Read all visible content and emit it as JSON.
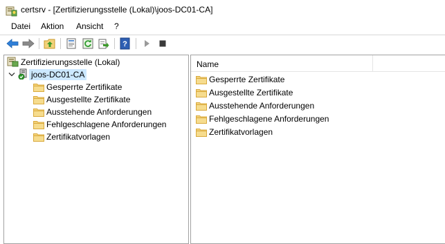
{
  "window": {
    "title": "certsrv - [Zertifizierungsstelle (Lokal)\\joos-DC01-CA]"
  },
  "menu": {
    "items": [
      "Datei",
      "Aktion",
      "Ansicht",
      "?"
    ]
  },
  "toolbar": {
    "buttons": [
      "back-icon",
      "forward-icon",
      "up-folder-icon",
      "properties-icon",
      "refresh-icon",
      "export-icon",
      "help-icon",
      "play-icon",
      "stop-icon"
    ]
  },
  "tree": {
    "root": "Zertifizierungsstelle (Lokal)",
    "ca": "joos-DC01-CA",
    "children": [
      "Gesperrte Zertifikate",
      "Ausgestellte Zertifikate",
      "Ausstehende Anforderungen",
      "Fehlgeschlagene Anforderungen",
      "Zertifikatvorlagen"
    ]
  },
  "list": {
    "column_name": "Name",
    "items": [
      "Gesperrte Zertifikate",
      "Ausgestellte Zertifikate",
      "Ausstehende Anforderungen",
      "Fehlgeschlagene Anforderungen",
      "Zertifikatvorlagen"
    ]
  },
  "colors": {
    "selection": "#cce8ff",
    "folder": "#f3d27a",
    "folder_dark": "#d9a93c"
  }
}
